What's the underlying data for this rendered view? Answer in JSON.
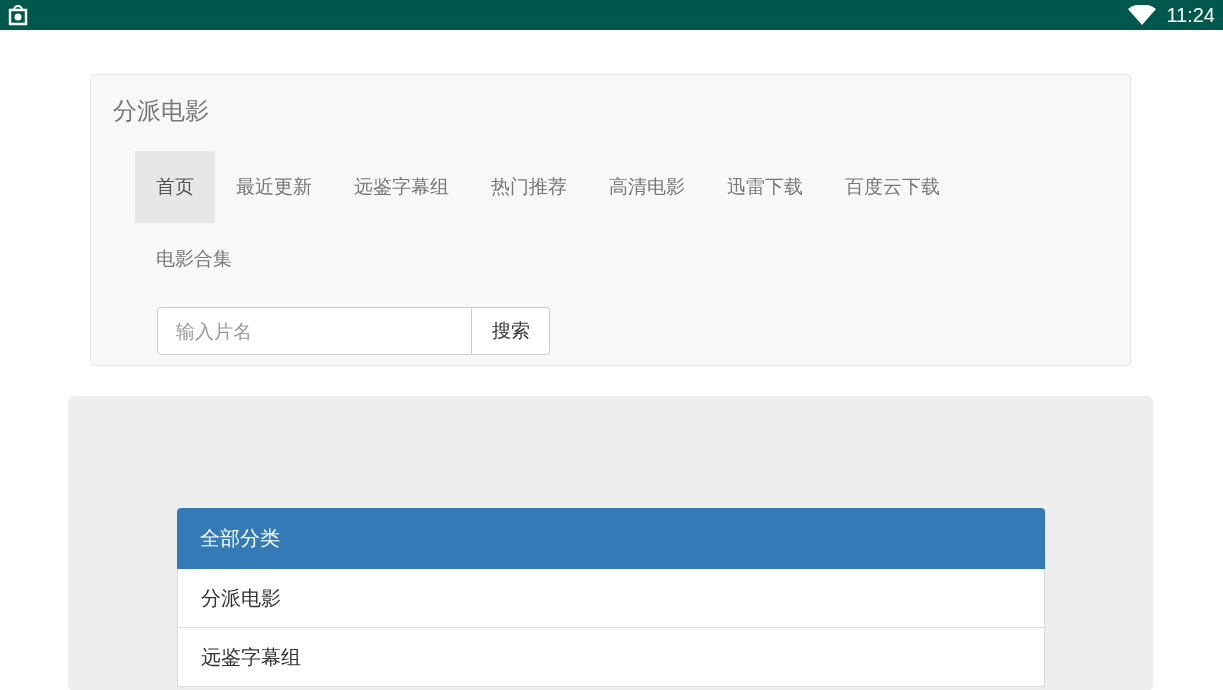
{
  "status_bar": {
    "time": "11:24"
  },
  "navbar": {
    "brand": "分派电影",
    "items": [
      {
        "label": "首页",
        "selected": true
      },
      {
        "label": "最近更新",
        "selected": false
      },
      {
        "label": "远鉴字幕组",
        "selected": false
      },
      {
        "label": "热门推荐",
        "selected": false
      },
      {
        "label": "高清电影",
        "selected": false
      },
      {
        "label": "迅雷下载",
        "selected": false
      },
      {
        "label": "百度云下载",
        "selected": false
      },
      {
        "label": "电影合集",
        "selected": false
      }
    ],
    "search": {
      "placeholder": "输入片名",
      "button": "搜索"
    }
  },
  "category_list": {
    "header": "全部分类",
    "items": [
      "分派电影",
      "远鉴字幕组"
    ]
  }
}
